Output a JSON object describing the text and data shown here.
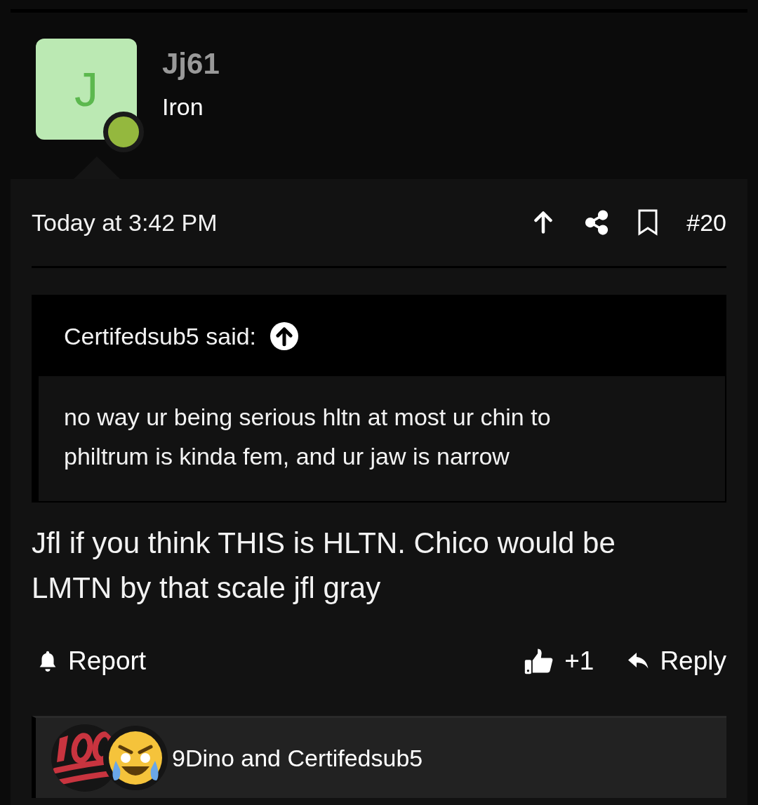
{
  "user": {
    "initial": "J",
    "name": "Jj61",
    "title": "Iron",
    "online": true
  },
  "post": {
    "date": "Today at 3:42 PM",
    "number": "#20"
  },
  "quote": {
    "author": "Certifedsub5 said:",
    "text": "no way ur being serious hltn at most ur chin to philtrum is kinda fem, and ur jaw is narrow"
  },
  "body": "Jfl if you think THIS is HLTN. Chico would be LMTN by that scale jfl gray",
  "actions": {
    "report": "Report",
    "likes": "+1",
    "reply": "Reply"
  },
  "reactions": {
    "text": "9Dino and Certifedsub5"
  }
}
